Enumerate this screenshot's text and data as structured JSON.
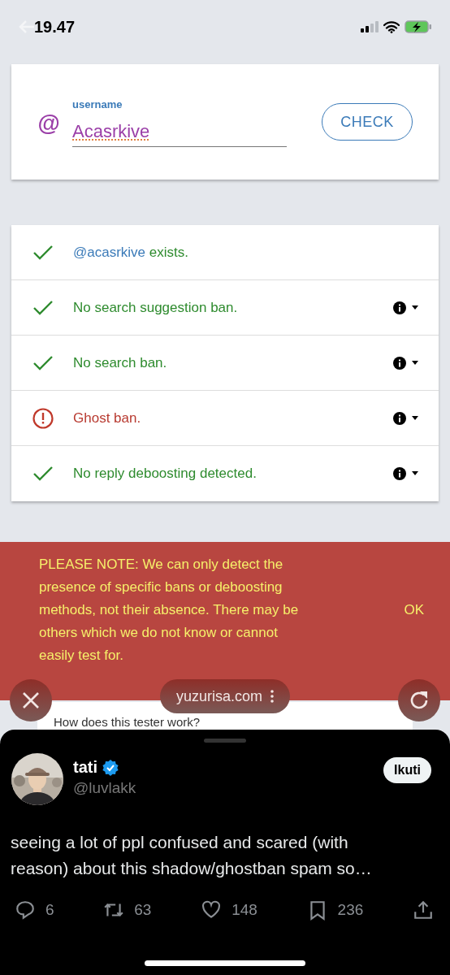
{
  "status_bar": {
    "time": "19.47"
  },
  "username_form": {
    "prefix": "@",
    "label": "username",
    "value": "Acasrkive",
    "button": "CHECK"
  },
  "results": [
    {
      "kind": "ok",
      "handle": "@acasrkive",
      "text": "exists.",
      "info": false
    },
    {
      "kind": "ok",
      "text": "No search suggestion ban.",
      "info": true
    },
    {
      "kind": "ok",
      "text": "No search ban.",
      "info": true
    },
    {
      "kind": "alert",
      "text": "Ghost ban.",
      "info": true
    },
    {
      "kind": "ok",
      "text": "No reply deboosting detected.",
      "info": true
    }
  ],
  "notice": {
    "text": "PLEASE NOTE: We can only detect the presence of specific bans or deboosting methods, not their absence. There may be others which we do not know or cannot easily test for.",
    "button": "OK"
  },
  "browser_bar": {
    "url": "yuzurisa.com"
  },
  "faq_card": {
    "title": "How does this tester work?"
  },
  "post": {
    "name": "tati",
    "verified": true,
    "handle": "@luvlakk",
    "follow_button": "Ikuti",
    "text": "seeing a lot of ppl confused and scared (with reason) about this shadow/ghostban spam so…",
    "actions": [
      {
        "kind": "reply",
        "count": "6"
      },
      {
        "kind": "repost",
        "count": "63"
      },
      {
        "kind": "like",
        "count": "148"
      },
      {
        "kind": "bookmark",
        "count": "236"
      },
      {
        "kind": "share"
      }
    ]
  }
}
